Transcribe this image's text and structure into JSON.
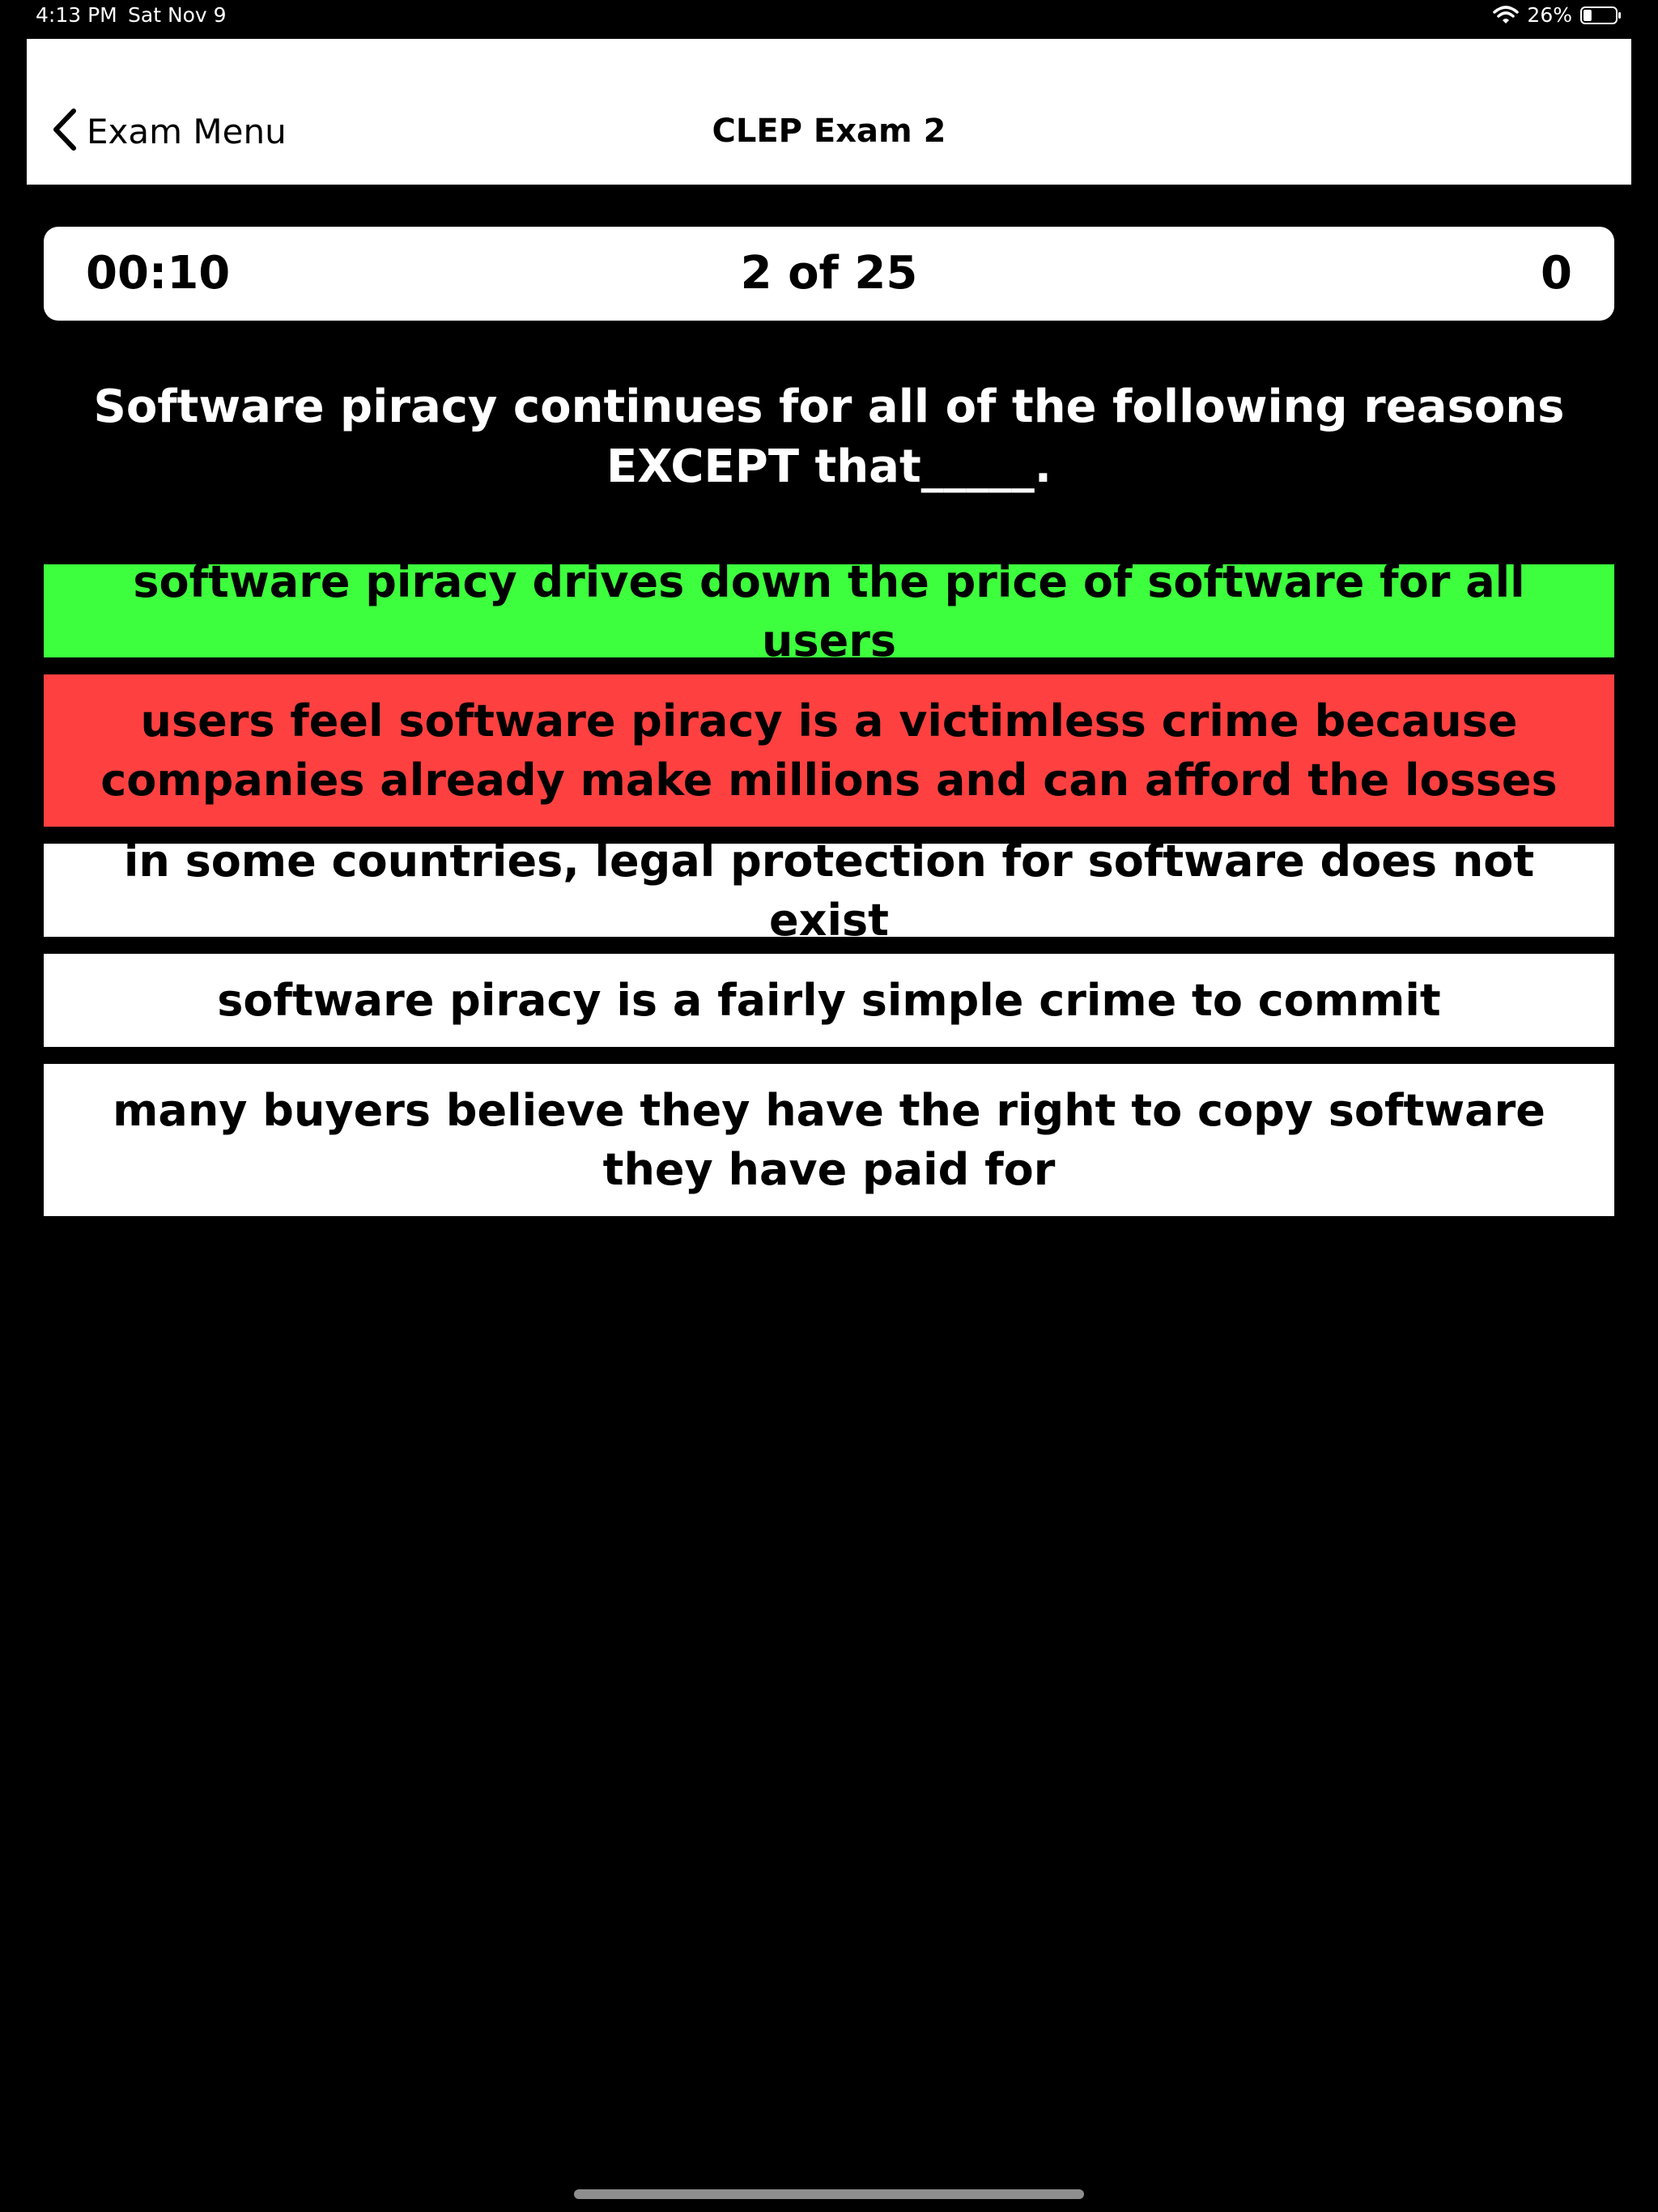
{
  "status_bar": {
    "time": "4:13 PM",
    "date": "Sat Nov 9",
    "battery_percent": "26%",
    "battery_level": 0.26
  },
  "nav": {
    "back_label": "Exam Menu",
    "title": "CLEP Exam 2"
  },
  "info": {
    "timer": "00:10",
    "progress": "2 of 25",
    "score": "0"
  },
  "question": {
    "text": "Software piracy continues for all of the following reasons EXCEPT that_____."
  },
  "answers": [
    {
      "text": "software piracy drives down the price of software for all users",
      "state": "correct",
      "color": "#3dff3d"
    },
    {
      "text": "users feel software piracy is a victimless crime because companies already make millions and can afford the losses",
      "state": "incorrect",
      "color": "#ff4040"
    },
    {
      "text": "in some countries, legal protection for software does not exist",
      "state": "neutral",
      "color": "#ffffff"
    },
    {
      "text": "software piracy is a fairly simple crime to commit",
      "state": "neutral",
      "color": "#ffffff"
    },
    {
      "text": "many buyers believe they have the right to copy software they have paid for",
      "state": "neutral",
      "color": "#ffffff"
    }
  ]
}
